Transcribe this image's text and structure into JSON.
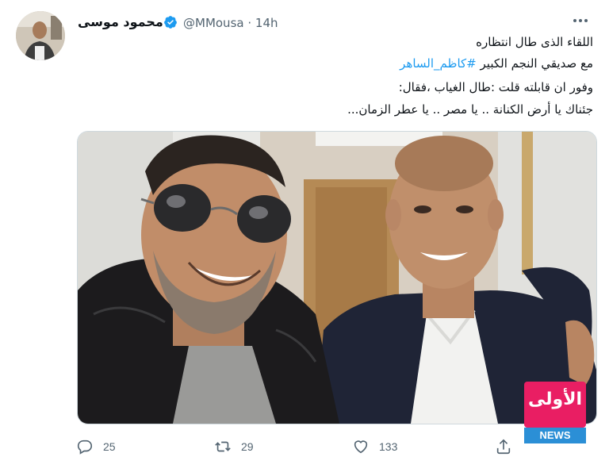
{
  "tweet": {
    "author_name": "محمود موسى",
    "handle": "@MMousa",
    "time": "· 14h",
    "lines": [
      "اللقاء الذى طال انتظاره",
      "وفور ان قابلته قلت :طال الغياب ،فقال:",
      "جئناك يا أرض الكنانة .. يا مصر .. يا عطر الزمان..."
    ],
    "line2_prefix": "مع صديقي النجم الكبير ",
    "hashtag": "#كاظم_الساهر"
  },
  "actions": {
    "reply_count": "25",
    "retweet_count": "29",
    "like_count": "133"
  },
  "watermark": {
    "brand_text": "الأولى",
    "news_label": "NEWS"
  },
  "icons": {
    "verified": "verified-badge-icon",
    "more": "more-dots-icon",
    "reply": "reply-icon",
    "retweet": "retweet-icon",
    "like": "heart-icon",
    "share": "share-icon"
  },
  "colors": {
    "accent": "#1d9bf0",
    "secondary_text": "#536471",
    "watermark_pink": "#e91e63",
    "watermark_blue": "#2b8fd6"
  }
}
